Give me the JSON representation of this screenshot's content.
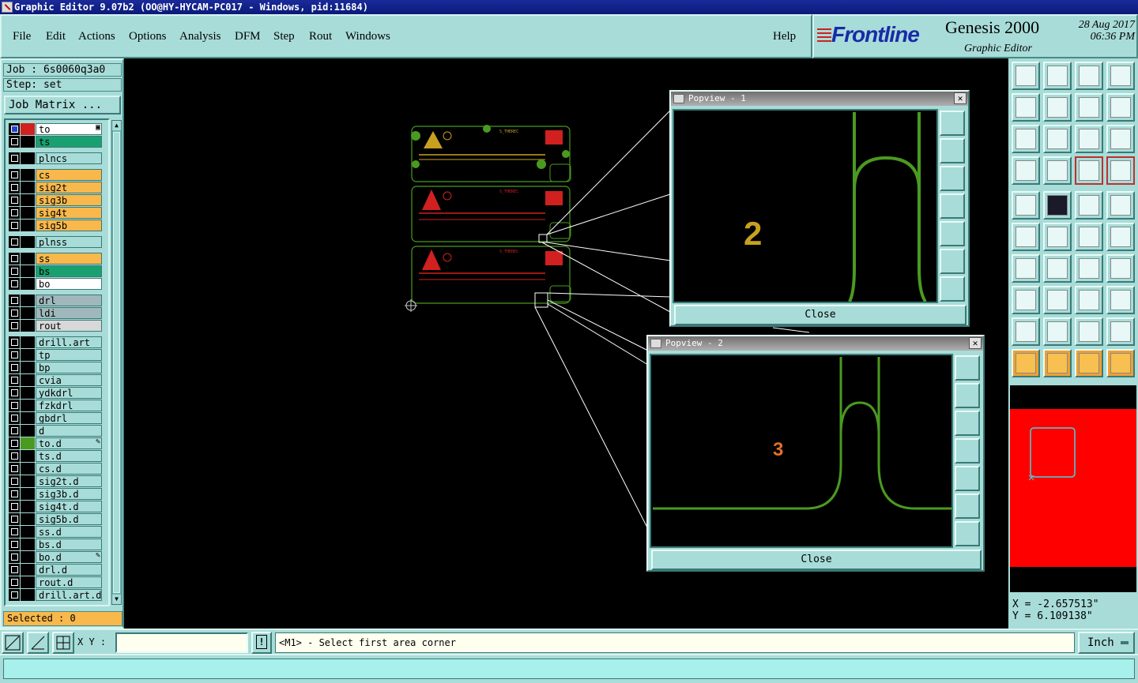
{
  "window": {
    "title": "Graphic Editor 9.07b2 (OO@HY-HYCAM-PC017 - Windows, pid:11684)"
  },
  "menu": {
    "items": [
      "File",
      "Edit",
      "Actions",
      "Options",
      "Analysis",
      "DFM",
      "Step",
      "Rout",
      "Windows"
    ],
    "help": "Help"
  },
  "brand": {
    "logo": "Frontline",
    "product": "Genesis 2000",
    "subtitle": "Graphic Editor",
    "date": "28 Aug 2017",
    "time": "06:36 PM"
  },
  "left": {
    "job": "Job : 6s0060q3a0",
    "step": "Step: set",
    "job_matrix": "Job Matrix ...",
    "selected": "Selected : 0",
    "layers": [
      {
        "name": "to",
        "color": "#d02020",
        "bg": "#ffffff",
        "checked": true,
        "mark": "▣"
      },
      {
        "name": "ts",
        "color": "#000000",
        "bg": "#1aa070",
        "checked": false
      },
      {
        "name": "plncs",
        "color": "#000000",
        "bg": "#a8dcd8",
        "checked": false
      },
      {
        "name": "cs",
        "color": "#000000",
        "bg": "#f8b84c",
        "checked": false
      },
      {
        "name": "sig2t",
        "color": "#000000",
        "bg": "#f8b84c",
        "checked": false
      },
      {
        "name": "sig3b",
        "color": "#000000",
        "bg": "#f8b84c",
        "checked": false
      },
      {
        "name": "sig4t",
        "color": "#000000",
        "bg": "#f8b84c",
        "checked": false
      },
      {
        "name": "sig5b",
        "color": "#000000",
        "bg": "#f8b84c",
        "checked": false
      },
      {
        "name": "plnss",
        "color": "#000000",
        "bg": "#a8dcd8",
        "checked": false
      },
      {
        "name": "ss",
        "color": "#000000",
        "bg": "#f8b84c",
        "checked": false
      },
      {
        "name": "bs",
        "color": "#000000",
        "bg": "#1aa070",
        "checked": false
      },
      {
        "name": "bo",
        "color": "#000000",
        "bg": "#ffffff",
        "checked": false
      },
      {
        "name": "drl",
        "color": "#000000",
        "bg": "#a0b8bc",
        "checked": false
      },
      {
        "name": "ldi",
        "color": "#000000",
        "bg": "#a0b8bc",
        "checked": false
      },
      {
        "name": "rout",
        "color": "#000000",
        "bg": "#d8d8d8",
        "checked": false
      },
      {
        "name": "drill.art",
        "color": "#000000",
        "bg": "#a8dcd8",
        "checked": false
      },
      {
        "name": "tp",
        "color": "#000000",
        "bg": "#a8dcd8",
        "checked": false
      },
      {
        "name": "bp",
        "color": "#000000",
        "bg": "#a8dcd8",
        "checked": false
      },
      {
        "name": "cvia",
        "color": "#000000",
        "bg": "#a8dcd8",
        "checked": false
      },
      {
        "name": "ydkdrl",
        "color": "#000000",
        "bg": "#a8dcd8",
        "checked": false
      },
      {
        "name": "fzkdrl",
        "color": "#000000",
        "bg": "#a8dcd8",
        "checked": false
      },
      {
        "name": "gbdrl",
        "color": "#000000",
        "bg": "#a8dcd8",
        "checked": false
      },
      {
        "name": "d",
        "color": "#000000",
        "bg": "#a8dcd8",
        "checked": false
      },
      {
        "name": "to.d",
        "color": "#4a9a20",
        "bg": "#a8dcd8",
        "checked": false,
        "mark": "✎"
      },
      {
        "name": "ts.d",
        "color": "#000000",
        "bg": "#a8dcd8",
        "checked": false
      },
      {
        "name": "cs.d",
        "color": "#000000",
        "bg": "#a8dcd8",
        "checked": false
      },
      {
        "name": "sig2t.d",
        "color": "#000000",
        "bg": "#a8dcd8",
        "checked": false
      },
      {
        "name": "sig3b.d",
        "color": "#000000",
        "bg": "#a8dcd8",
        "checked": false
      },
      {
        "name": "sig4t.d",
        "color": "#000000",
        "bg": "#a8dcd8",
        "checked": false
      },
      {
        "name": "sig5b.d",
        "color": "#000000",
        "bg": "#a8dcd8",
        "checked": false
      },
      {
        "name": "ss.d",
        "color": "#000000",
        "bg": "#a8dcd8",
        "checked": false
      },
      {
        "name": "bs.d",
        "color": "#000000",
        "bg": "#a8dcd8",
        "checked": false
      },
      {
        "name": "bo.d",
        "color": "#000000",
        "bg": "#a8dcd8",
        "checked": false,
        "mark": "✎"
      },
      {
        "name": "drl.d",
        "color": "#000000",
        "bg": "#a8dcd8",
        "checked": false
      },
      {
        "name": "rout.d",
        "color": "#000000",
        "bg": "#a8dcd8",
        "checked": false
      },
      {
        "name": "drill.art.d",
        "color": "#000000",
        "bg": "#a8dcd8",
        "checked": false
      }
    ]
  },
  "popview1": {
    "title": "Popview - 1",
    "label": "2",
    "close": "Close"
  },
  "popview2": {
    "title": "Popview - 2",
    "label": "3",
    "close": "Close"
  },
  "coords": {
    "x": "X = -2.657513\"",
    "y": "Y = 6.109138\""
  },
  "bottom": {
    "xy_label": "X Y :",
    "xy_value": "",
    "message": "<M1> - Select first area corner",
    "unit": "Inch"
  },
  "colors": {
    "panel": "#a8dcd8",
    "trace_green": "#4a9a20",
    "pcb_red": "#d02020",
    "selected_orange": "#f8b84c"
  }
}
